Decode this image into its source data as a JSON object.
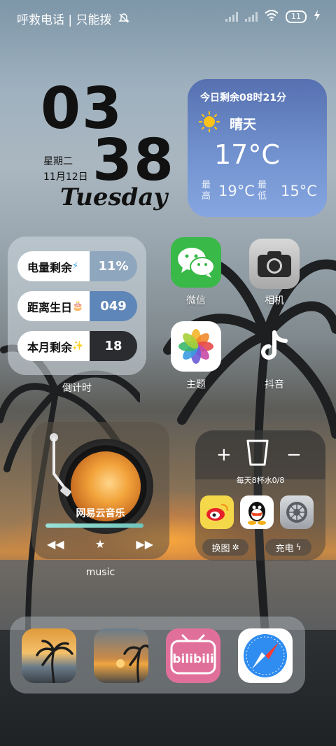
{
  "status": {
    "carrier_text": "呼救电话 | 只能拨",
    "battery": "11"
  },
  "clock": {
    "hour": "03",
    "minute": "38",
    "weekday": "星期二",
    "date": "11月12日",
    "day_en": "Tuesday"
  },
  "weather": {
    "remaining": "今日剩余08时21分",
    "condition": "晴天",
    "temp": "17°C",
    "high_label": "最高",
    "high": "19°C",
    "low_label": "最低",
    "low": "15°C"
  },
  "countdown": {
    "rows": [
      {
        "label": "电量剩余",
        "emoji": "⚡",
        "value": "11%"
      },
      {
        "label": "距离生日",
        "emoji": "🎂",
        "value": "049"
      },
      {
        "label": "本月剩余",
        "emoji": "✨",
        "value": "18"
      }
    ],
    "caption": "倒计时"
  },
  "apps": {
    "wechat": "微信",
    "camera": "相机",
    "theme": "主题",
    "douyin": "抖音"
  },
  "music": {
    "title": "网易云音乐",
    "caption": "music"
  },
  "water": {
    "plus": "+",
    "minus": "−",
    "text": "每天8杯水0/8",
    "btn_wallpaper": "换图",
    "btn_charge": "充电"
  },
  "dock": {
    "bilibili": "bilibili"
  }
}
